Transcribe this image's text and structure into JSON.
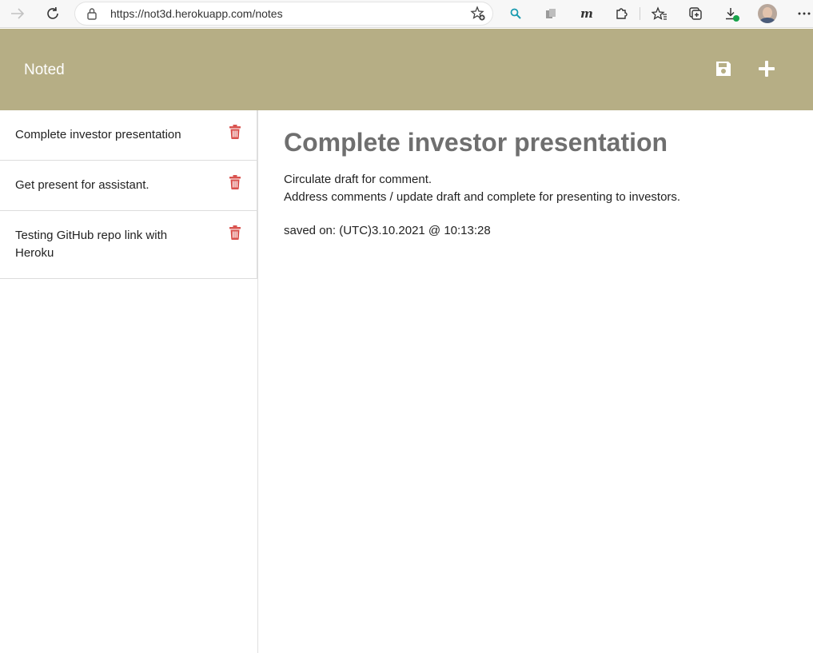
{
  "browser": {
    "url": "https://not3d.herokuapp.com/notes"
  },
  "app": {
    "title": "Noted",
    "colors": {
      "header": "#b6ae85",
      "trash": "#d9534f",
      "heading": "#6f6f6f"
    },
    "icons": {
      "save": "save-icon",
      "add": "plus-icon",
      "delete": "trash-icon"
    }
  },
  "notes": [
    {
      "title": "Complete investor presentation"
    },
    {
      "title": "Get present for assistant."
    },
    {
      "title": "Testing GitHub repo link with Heroku"
    }
  ],
  "active_note": {
    "title": "Complete investor presentation",
    "body_lines": [
      "Circulate draft for comment.",
      "Address comments / update draft and complete for presenting to investors."
    ],
    "saved_label": "saved on:  (UTC)3.10.2021 @ 10:13:28"
  }
}
